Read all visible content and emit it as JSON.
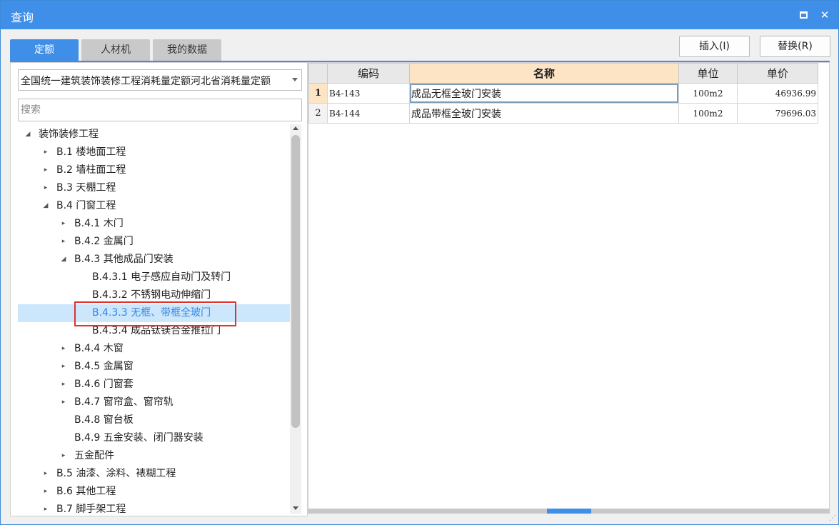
{
  "window": {
    "title": "查询"
  },
  "tabs": [
    {
      "label": "定额"
    },
    {
      "label": "人材机"
    },
    {
      "label": "我的数据"
    }
  ],
  "buttons": {
    "insert": "插入(I)",
    "replace": "替换(R)"
  },
  "library": {
    "selected": "全国统一建筑装饰装修工程消耗量定额河北省消耗量定额"
  },
  "search": {
    "placeholder": "搜索"
  },
  "tree": [
    {
      "label": "装饰装修工程",
      "level": 0,
      "toggle": "◢"
    },
    {
      "label": "B.1 楼地面工程",
      "level": 1,
      "toggle": "▸"
    },
    {
      "label": "B.2 墙柱面工程",
      "level": 1,
      "toggle": "▸"
    },
    {
      "label": "B.3 天棚工程",
      "level": 1,
      "toggle": "▸"
    },
    {
      "label": "B.4 门窗工程",
      "level": 1,
      "toggle": "◢"
    },
    {
      "label": "B.4.1 木门",
      "level": 2,
      "toggle": "▸"
    },
    {
      "label": "B.4.2 金属门",
      "level": 2,
      "toggle": "▸"
    },
    {
      "label": "B.4.3 其他成品门安装",
      "level": 2,
      "toggle": "◢"
    },
    {
      "label": "B.4.3.1 电子感应自动门及转门",
      "level": 3,
      "toggle": ""
    },
    {
      "label": "B.4.3.2 不锈钢电动伸缩门",
      "level": 3,
      "toggle": ""
    },
    {
      "label": "B.4.3.3 无框、带框全玻门",
      "level": 3,
      "toggle": "",
      "selected": true
    },
    {
      "label": "B.4.3.4 成品钛镁合金推拉门",
      "level": 3,
      "toggle": ""
    },
    {
      "label": "B.4.4 木窗",
      "level": 2,
      "toggle": "▸"
    },
    {
      "label": "B.4.5 金属窗",
      "level": 2,
      "toggle": "▸"
    },
    {
      "label": "B.4.6 门窗套",
      "level": 2,
      "toggle": "▸"
    },
    {
      "label": "B.4.7 窗帘盒、窗帘轨",
      "level": 2,
      "toggle": "▸"
    },
    {
      "label": "B.4.8 窗台板",
      "level": 2,
      "toggle": ""
    },
    {
      "label": "B.4.9 五金安装、闭门器安装",
      "level": 2,
      "toggle": ""
    },
    {
      "label": "五金配件",
      "level": 2,
      "toggle": "▸"
    },
    {
      "label": "B.5 油漆、涂料、裱糊工程",
      "level": 1,
      "toggle": "▸"
    },
    {
      "label": "B.6 其他工程",
      "level": 1,
      "toggle": "▸"
    },
    {
      "label": "B.7 脚手架工程",
      "level": 1,
      "toggle": "▸"
    }
  ],
  "table": {
    "columns": [
      "编码",
      "名称",
      "单位",
      "单价"
    ],
    "rows": [
      {
        "index": "1",
        "code": "B4-143",
        "name": "成品无框全玻门安装",
        "unit": "100m2",
        "price": "46936.99"
      },
      {
        "index": "2",
        "code": "B4-144",
        "name": "成品带框全玻门安装",
        "unit": "100m2",
        "price": "79696.03"
      }
    ]
  }
}
